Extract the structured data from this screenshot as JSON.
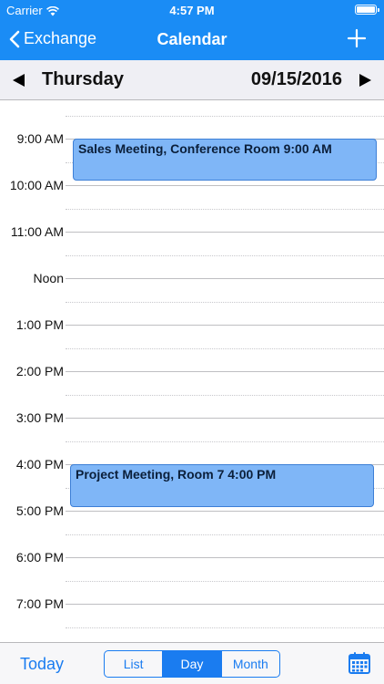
{
  "status": {
    "carrier": "Carrier",
    "time": "4:57 PM"
  },
  "nav": {
    "back_label": "Exchange",
    "title": "Calendar"
  },
  "datebar": {
    "day": "Thursday",
    "date": "09/15/2016"
  },
  "schedule": {
    "hours": [
      "9:00 AM",
      "10:00 AM",
      "11:00 AM",
      "Noon",
      "1:00 PM",
      "2:00 PM",
      "3:00 PM",
      "4:00 PM",
      "5:00 PM",
      "6:00 PM",
      "7:00 PM"
    ],
    "events": [
      {
        "title": "Sales Meeting, Conference Room 9:00 AM",
        "start_hour": 9.0,
        "end_hour": 9.9
      },
      {
        "title": "Project Meeting, Room 7 4:00 PM",
        "start_hour": 16.0,
        "end_hour": 16.93
      }
    ]
  },
  "toolbar": {
    "today_label": "Today",
    "segments": [
      {
        "label": "List",
        "active": false
      },
      {
        "label": "Day",
        "active": true
      },
      {
        "label": "Month",
        "active": false
      }
    ]
  },
  "colors": {
    "accent": "#1a8cf5",
    "event_fill": "#7fb6f7",
    "event_border": "#3d7fd6"
  }
}
